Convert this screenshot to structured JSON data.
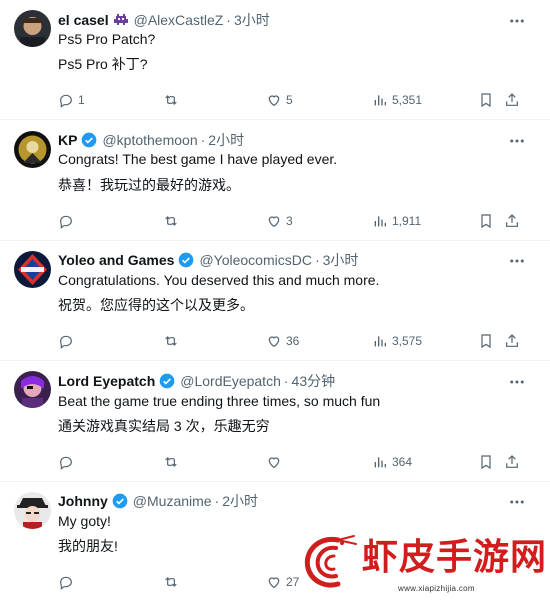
{
  "colors": {
    "verified_blue": "#1d9bf0",
    "muted_gray": "#536471",
    "watermark_red": "#d21d1d"
  },
  "replies": [
    {
      "name": "el casel",
      "verified": false,
      "badge_icon": "alien-invader-emoji-icon",
      "handle": "@AlexCastleZ",
      "time": "3小时",
      "lines": [
        "Ps5 Pro Patch?",
        "Ps5 Pro 补丁?"
      ],
      "counts": {
        "reply": "1",
        "repost": "",
        "like": "5",
        "views": "5,351"
      }
    },
    {
      "name": "KP",
      "verified": true,
      "handle": "@kptothemoon",
      "time": "2小时",
      "lines": [
        "Congrats! The best game I have played ever.",
        "恭喜！我玩过的最好的游戏。"
      ],
      "counts": {
        "reply": "",
        "repost": "",
        "like": "3",
        "views": "1,911"
      }
    },
    {
      "name": "Yoleo and Games",
      "verified": true,
      "handle": "@YoleocomicsDC",
      "time": "3小时",
      "lines": [
        "Congratulations. You deserved this and much more.",
        "祝贺。您应得的这个以及更多。"
      ],
      "counts": {
        "reply": "",
        "repost": "",
        "like": "36",
        "views": "3,575"
      }
    },
    {
      "name": "Lord Eyepatch",
      "verified": true,
      "handle": "@LordEyepatch",
      "time": "43分钟",
      "lines": [
        "Beat the game true ending three times, so much fun",
        "通关游戏真实结局 3 次，乐趣无穷"
      ],
      "counts": {
        "reply": "",
        "repost": "",
        "like": "",
        "views": "364"
      }
    },
    {
      "name": "Johnny",
      "verified": true,
      "handle": "@Muzanime",
      "time": "2小时",
      "lines": [
        "My goty!",
        "我的朋友!"
      ],
      "counts": {
        "reply": "",
        "repost": "",
        "like": "27",
        "views": ""
      }
    }
  ],
  "watermark": {
    "text": "虾皮手游网",
    "url": "www.xiapizhijia.com"
  }
}
